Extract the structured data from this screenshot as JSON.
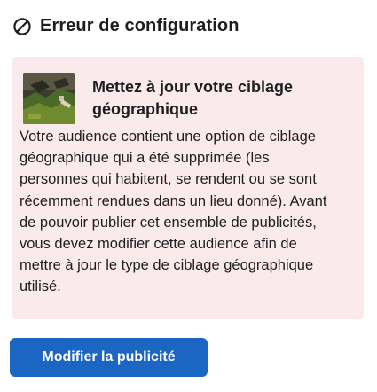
{
  "header": {
    "icon": "prohibited-icon",
    "title": "Erreur de configuration"
  },
  "notice": {
    "thumbnail": "ad-thumbnail-image",
    "title": "Mettez à jour votre ciblage géographique",
    "body": "Votre audience contient une option de ciblage\ngéographique qui a été supprimée (les\npersonnes qui habitent, se rendent ou se sont\nrécemment rendues dans un lieu donné). Avant\nde pouvoir publier cet ensemble de publicités,\nvous devez modifier cette audience afin de\nmettre à jour le type de ciblage géographique\nutilisé.",
    "background_color": "#fbeaec"
  },
  "actions": {
    "edit_ad_label": "Modifier la publicité",
    "button_color": "#1a66c2"
  }
}
